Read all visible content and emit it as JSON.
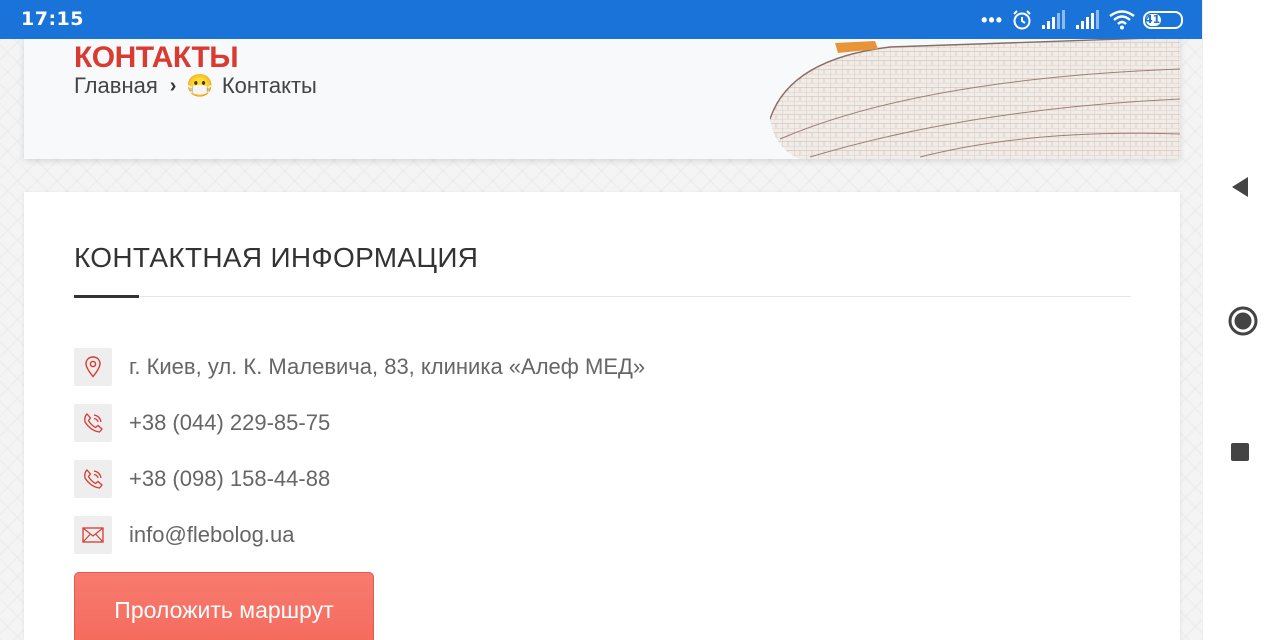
{
  "status_bar": {
    "time": "17:15",
    "battery_level": "41",
    "icons": [
      "more-dots-icon",
      "alarm-icon",
      "signal-icon",
      "signal-icon",
      "wifi-icon",
      "battery-icon"
    ]
  },
  "header": {
    "title": "КОНТАКТЫ",
    "breadcrumb": {
      "home": "Главная",
      "separator": "›",
      "emoji": "😷",
      "current": "Контакты"
    }
  },
  "contact_info": {
    "heading": "КОНТАКТНАЯ ИНФОРМАЦИЯ",
    "items": [
      {
        "icon": "location-pin-icon",
        "text": "г. Киев, ул. К. Малевича, 83, клиника «Алеф МЕД»"
      },
      {
        "icon": "phone-icon",
        "text": "+38 (044) 229-85-75"
      },
      {
        "icon": "phone-icon",
        "text": "+38 (098) 158-44-88"
      },
      {
        "icon": "mail-icon",
        "text": "info@flebolog.ua"
      }
    ],
    "route_button": "Проложить маршрут"
  },
  "colors": {
    "status_bar": "#1a73d9",
    "accent_red": "#d93a32",
    "button": "#f5695c"
  }
}
